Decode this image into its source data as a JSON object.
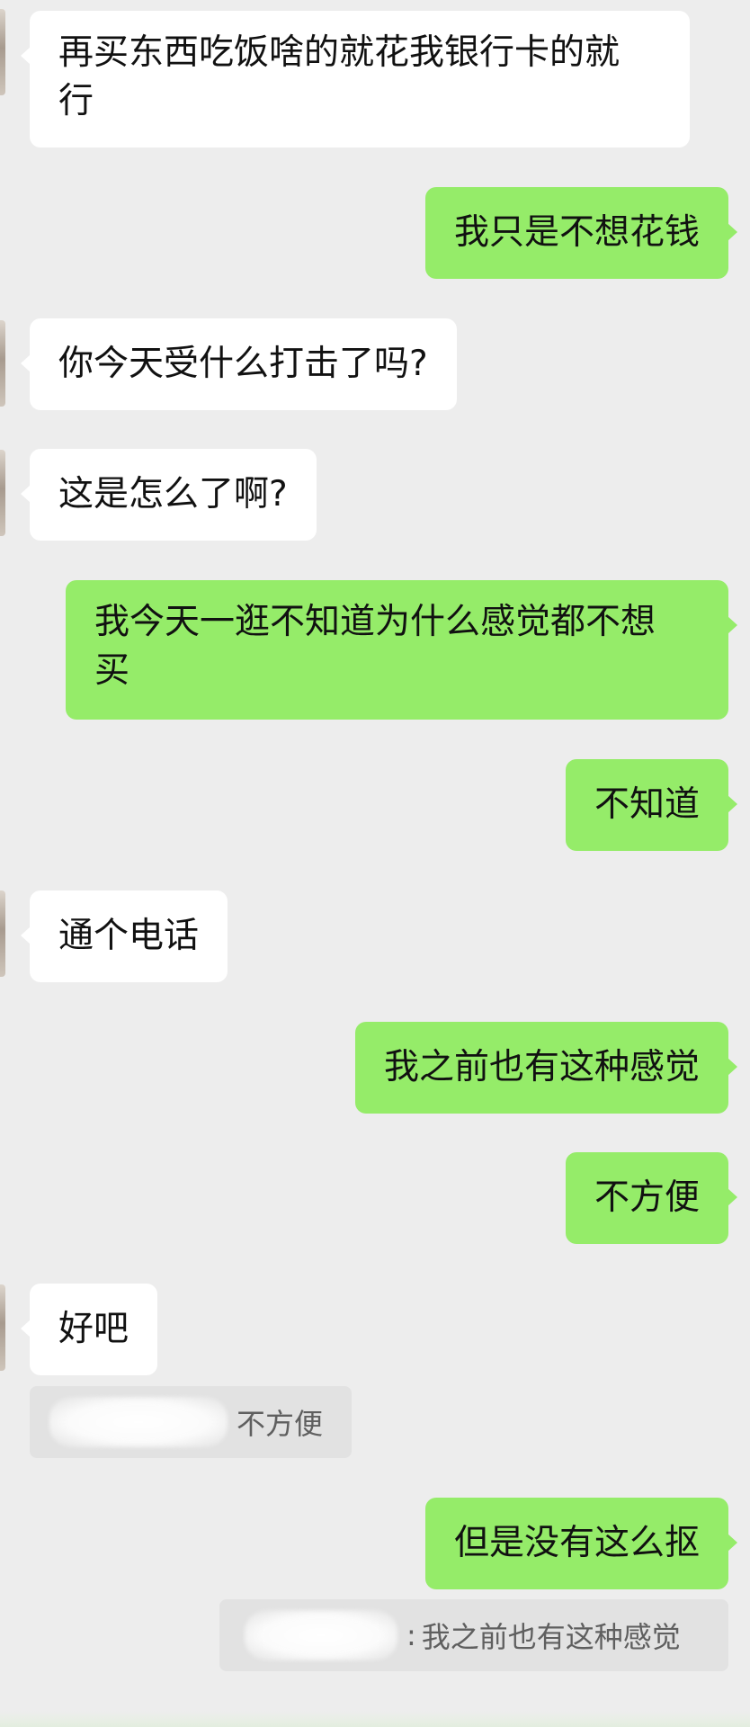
{
  "messages": [
    {
      "side": "left",
      "text": "再买东西吃饭啥的就花我银行卡的就\n行"
    },
    {
      "side": "right",
      "text": "我只是不想花钱"
    },
    {
      "side": "left",
      "text": "你今天受什么打击了吗?"
    },
    {
      "side": "left",
      "text": "这是怎么了啊?"
    },
    {
      "side": "right",
      "text": "我今天一逛不知道为什么感觉都不想\n买"
    },
    {
      "side": "right",
      "text": "不知道"
    },
    {
      "side": "left",
      "text": "通个电话"
    },
    {
      "side": "right",
      "text": "我之前也有这种感觉"
    },
    {
      "side": "right",
      "text": "不方便"
    },
    {
      "side": "left",
      "text": "好吧"
    },
    {
      "side": "right",
      "text": "但是没有这么抠"
    }
  ],
  "quotes": [
    {
      "text": "不方便",
      "has_colon": false
    },
    {
      "text": "我之前也有这种感觉",
      "has_colon": true
    }
  ],
  "colors": {
    "background": "#ededed",
    "self_bubble": "#95ec69",
    "other_bubble": "#ffffff",
    "quote_box": "#e2e2e2"
  }
}
